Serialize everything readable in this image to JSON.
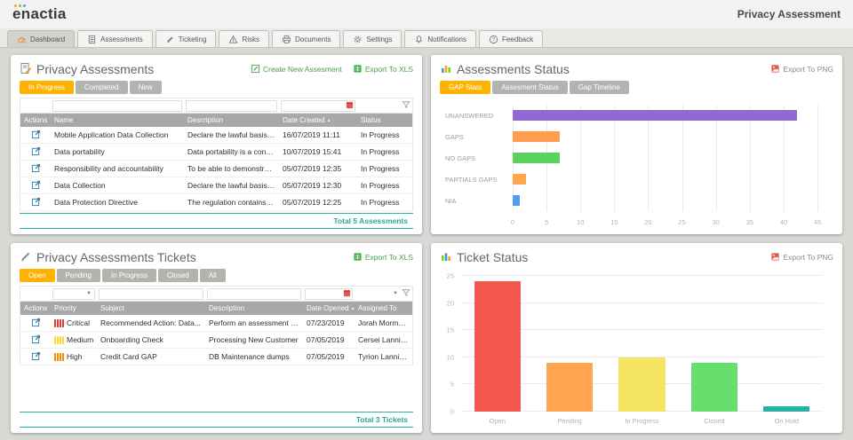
{
  "header": {
    "logo_text": "enactia",
    "page_title": "Privacy Assessment"
  },
  "nav_tabs": [
    {
      "label": "Dashboard",
      "active": true
    },
    {
      "label": "Assessments",
      "active": false
    },
    {
      "label": "Ticketing",
      "active": false
    },
    {
      "label": "Risks",
      "active": false
    },
    {
      "label": "Documents",
      "active": false
    },
    {
      "label": "Settings",
      "active": false
    },
    {
      "label": "Notifications",
      "active": false
    },
    {
      "label": "Feedback",
      "active": false
    }
  ],
  "assessments_panel": {
    "title": "Privacy Assessments",
    "create_link": "Create New Assesment",
    "export_link": "Export To XLS",
    "tabs": {
      "in_progress": "In Progress",
      "completed": "Completed",
      "new": "New"
    },
    "active_tab": "In Progress",
    "columns": {
      "actions": "Actions",
      "name": "Name",
      "description": "Description",
      "date": "Date Created",
      "status": "Status"
    },
    "rows": [
      {
        "name": "Mobile Application Data Collection",
        "description": "Declare the lawful basis and purpose ...",
        "date": "16/07/2019 11:11",
        "status": "In Progress"
      },
      {
        "name": "Data portability",
        "description": "Data portability is a concept to protec...",
        "date": "10/07/2019 15:41",
        "status": "In Progress"
      },
      {
        "name": "Responsibility and accountability",
        "description": "To be able to demonstrate complianc...",
        "date": "05/07/2019 12:35",
        "status": "In Progress"
      },
      {
        "name": "Data Collection",
        "description": "Declare the lawful basis and purpose ...",
        "date": "05/07/2019 12:30",
        "status": "In Progress"
      },
      {
        "name": "Data Protection Directive",
        "description": "The regulation contains provisions an...",
        "date": "05/07/2019 12:25",
        "status": "In Progress"
      }
    ],
    "footer": "Total 5 Assessments"
  },
  "status_panel": {
    "title": "Assessments Status",
    "export_link": "Export To PNG",
    "tabs": {
      "gap_stats": "GAP Stats",
      "assessment_status": "Assesment Status",
      "gap_timeline": "Gap Timeline"
    },
    "active_tab": "GAP Stats"
  },
  "tickets_panel": {
    "title": "Privacy Assessments Tickets",
    "export_link": "Export To XLS",
    "tabs": {
      "open": "Open",
      "pending": "Pending",
      "in_progress": "In Progress",
      "closed": "Closed",
      "all": "All"
    },
    "active_tab": "Open",
    "columns": {
      "actions": "Actions",
      "priority": "Priority",
      "subject": "Subject",
      "description": "Description",
      "date": "Date Opened",
      "assigned": "Assigned To"
    },
    "rows": [
      {
        "priority": "Critical",
        "priority_color": "#e53935",
        "subject": "Recommended Action: Data...",
        "description": "Perform an assessment to i...",
        "date": "07/23/2019",
        "assigned": "Jorah Mormont"
      },
      {
        "priority": "Medium",
        "priority_color": "#fdd835",
        "subject": "Onboarding Check",
        "description": "Processing New Customer",
        "date": "07/05/2019",
        "assigned": "Cersei Lannister"
      },
      {
        "priority": "High",
        "priority_color": "#fb8c00",
        "subject": "Credit Card GAP",
        "description": "DB Maintenance dumps",
        "date": "07/05/2019",
        "assigned": "Tyrion Lannister"
      }
    ],
    "footer": "Total 3 Tickets"
  },
  "ticket_status_panel": {
    "title": "Ticket Status",
    "export_link": "Export To PNG"
  },
  "chart_data": [
    {
      "type": "bar",
      "orientation": "horizontal",
      "title": "GAP Stats",
      "categories": [
        "UNANSWERED",
        "GAPS",
        "NO GAPS",
        "PARTIALS GAPS",
        "N/A"
      ],
      "values": [
        42,
        7,
        7,
        2,
        1
      ],
      "colors": [
        "#9268d1",
        "#ff9e4d",
        "#5bd25b",
        "#ffa64d",
        "#4f9cf0"
      ],
      "xlim": [
        0,
        45
      ],
      "xstep": 5,
      "grid": true,
      "legend": "none"
    },
    {
      "type": "bar",
      "orientation": "vertical",
      "title": "Ticket Status",
      "categories": [
        "Open",
        "Pending",
        "In Progress",
        "Closed",
        "On Hold"
      ],
      "values": [
        24,
        9,
        10,
        9,
        1
      ],
      "colors": [
        "#f2574d",
        "#ffa54f",
        "#f5e463",
        "#67df6c",
        "#27b3a2"
      ],
      "ylim": [
        0,
        25
      ],
      "ystep": 5,
      "grid": true,
      "legend": "none"
    }
  ]
}
